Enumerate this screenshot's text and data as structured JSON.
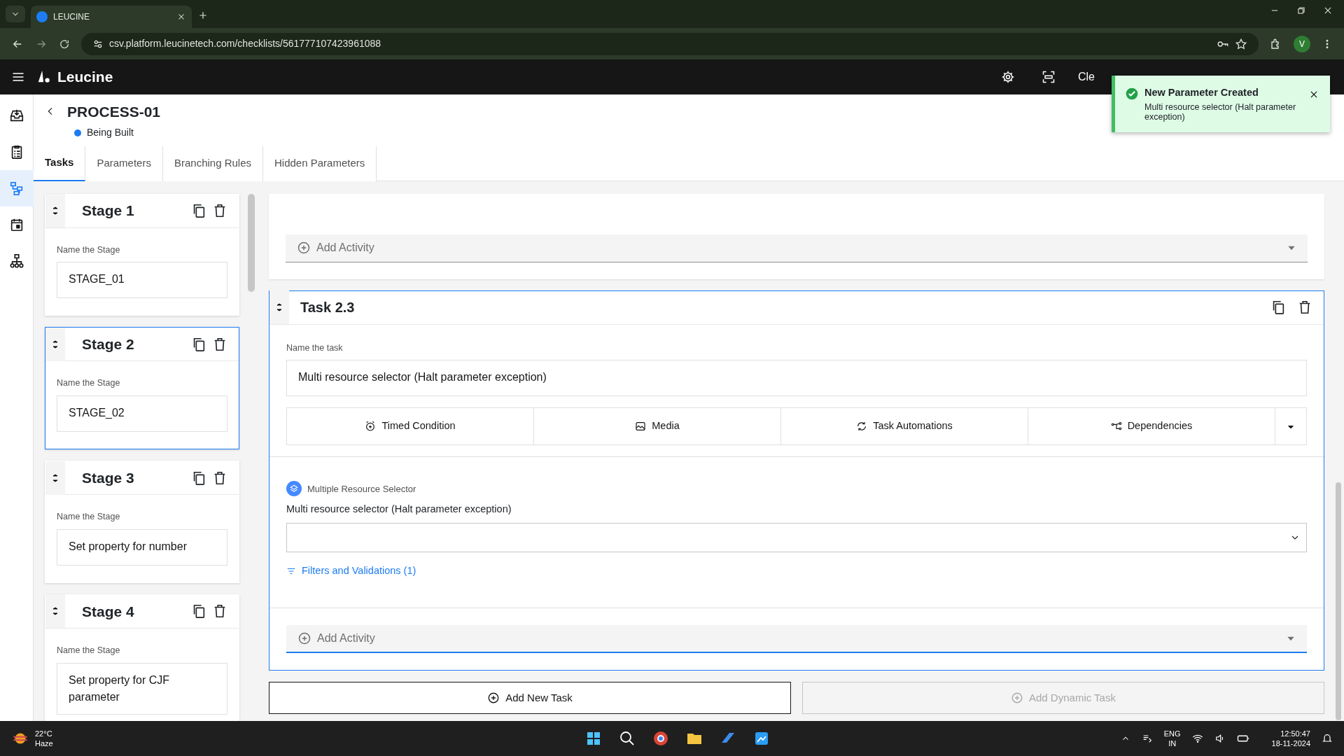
{
  "browser": {
    "tab_title": "LEUCINE",
    "url": "csv.platform.leucinetech.com/checklists/561777107423961088",
    "profile": "V"
  },
  "app": {
    "brand": "Leucine",
    "header_items": [
      "Cle"
    ]
  },
  "toast": {
    "title": "New Parameter Created",
    "message": "Multi resource selector (Halt parameter exception)"
  },
  "rail": [
    {
      "kind": "inbox",
      "selected": false
    },
    {
      "kind": "checklist",
      "selected": false
    },
    {
      "kind": "flow",
      "selected": true
    },
    {
      "kind": "calendar",
      "selected": false
    },
    {
      "kind": "hierarchy",
      "selected": false
    }
  ],
  "page": {
    "title": "PROCESS-01",
    "status": "Being Built"
  },
  "tabs": [
    {
      "label": "Tasks",
      "selected": true
    },
    {
      "label": "Parameters",
      "selected": false
    },
    {
      "label": "Branching Rules",
      "selected": false
    },
    {
      "label": "Hidden Parameters",
      "selected": false
    }
  ],
  "stages": [
    {
      "title": "Stage 1",
      "label": "Name the Stage",
      "value": "STAGE_01",
      "selected": false
    },
    {
      "title": "Stage 2",
      "label": "Name the Stage",
      "value": "STAGE_02",
      "selected": true
    },
    {
      "title": "Stage 3",
      "label": "Name the Stage",
      "value": "Set property for number",
      "selected": false
    },
    {
      "title": "Stage 4",
      "label": "Name the Stage",
      "value": "Set property for CJF parameter",
      "selected": false
    }
  ],
  "previous_task": {
    "add_activity": "Add Activity"
  },
  "task": {
    "title": "Task 2.3",
    "name_label": "Name the task",
    "name_value": "Multi resource selector (Halt parameter exception)",
    "actions": [
      {
        "kind": "timer",
        "label": "Timed Condition"
      },
      {
        "kind": "media",
        "label": "Media"
      },
      {
        "kind": "automation",
        "label": "Task Automations"
      },
      {
        "kind": "dependency",
        "label": "Dependencies"
      }
    ],
    "parameter": {
      "type_label": "Multiple Resource Selector",
      "label": "Multi resource selector (Halt parameter exception)",
      "filters": "Filters and Validations (1)"
    },
    "add_activity": "Add Activity"
  },
  "buttons": [
    {
      "label": "Add New Task",
      "disabled": false
    },
    {
      "label": "Add Dynamic Task",
      "disabled": true
    }
  ],
  "taskbar": {
    "temperature": "22°C",
    "weather": "Haze",
    "language": "ENG",
    "region": "IN",
    "time": "12:50:47",
    "date": "18-11-2024"
  }
}
